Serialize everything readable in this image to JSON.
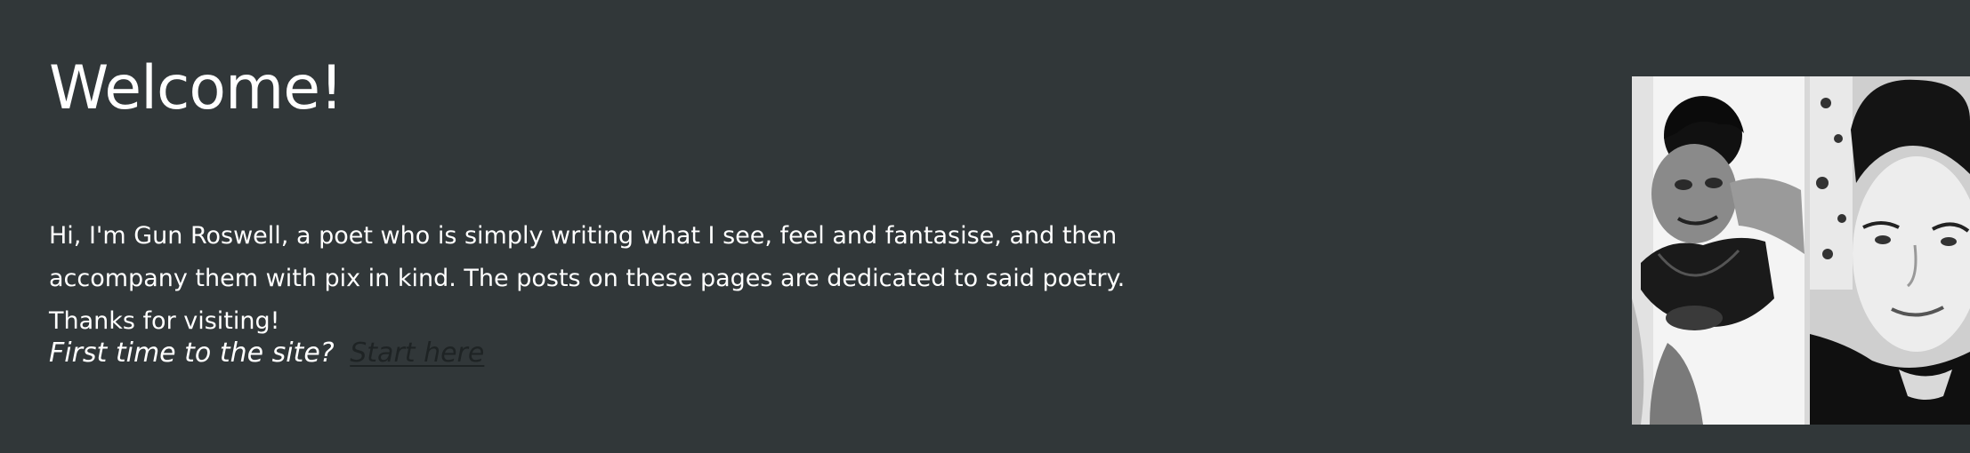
{
  "welcome": {
    "title": "Welcome!",
    "intro": "Hi, I'm Gun Roswell, a poet who is simply writing what I see, feel and fantasise, and then accompany them with pix in kind. The posts on these pages are dedicated to said poetry. Thanks for visiting!",
    "cta_question": "First time to the site?",
    "cta_link": "Start here"
  },
  "photo": {
    "icon": "author-photo-collage"
  },
  "colors": {
    "background": "#313739",
    "text": "#ffffff",
    "link": "#1e2324"
  }
}
